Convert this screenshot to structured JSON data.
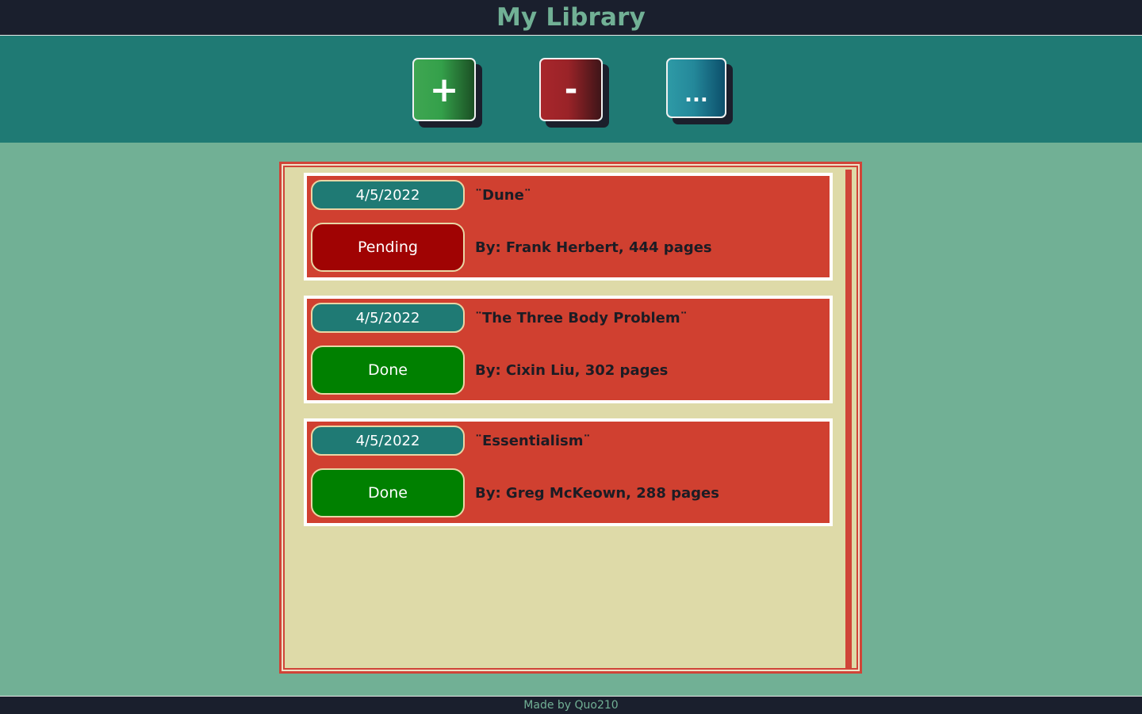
{
  "header": {
    "title": "My Library"
  },
  "toolbar": {
    "add_label": "+",
    "remove_label": "-",
    "more_label": "..."
  },
  "colors": {
    "background": "#71b095",
    "header_bg": "#1a1f2d",
    "toolbar_bg": "#1f7a74",
    "shelf_bg": "#dedaa8",
    "card_bg": "#d04030",
    "pending": "#a00303",
    "done": "#008000"
  },
  "books": [
    {
      "date": "4/5/2022",
      "title": "¨Dune¨",
      "meta": "By: Frank Herbert, 444 pages",
      "status": "Pending",
      "status_color": "#a00303"
    },
    {
      "date": "4/5/2022",
      "title": "¨The Three Body Problem¨",
      "meta": "By: Cixin Liu, 302 pages",
      "status": "Done",
      "status_color": "#008000"
    },
    {
      "date": "4/5/2022",
      "title": "¨Essentialism¨",
      "meta": "By: Greg McKeown, 288 pages",
      "status": "Done",
      "status_color": "#008000"
    }
  ],
  "footer": {
    "text": "Made by Quo210"
  }
}
